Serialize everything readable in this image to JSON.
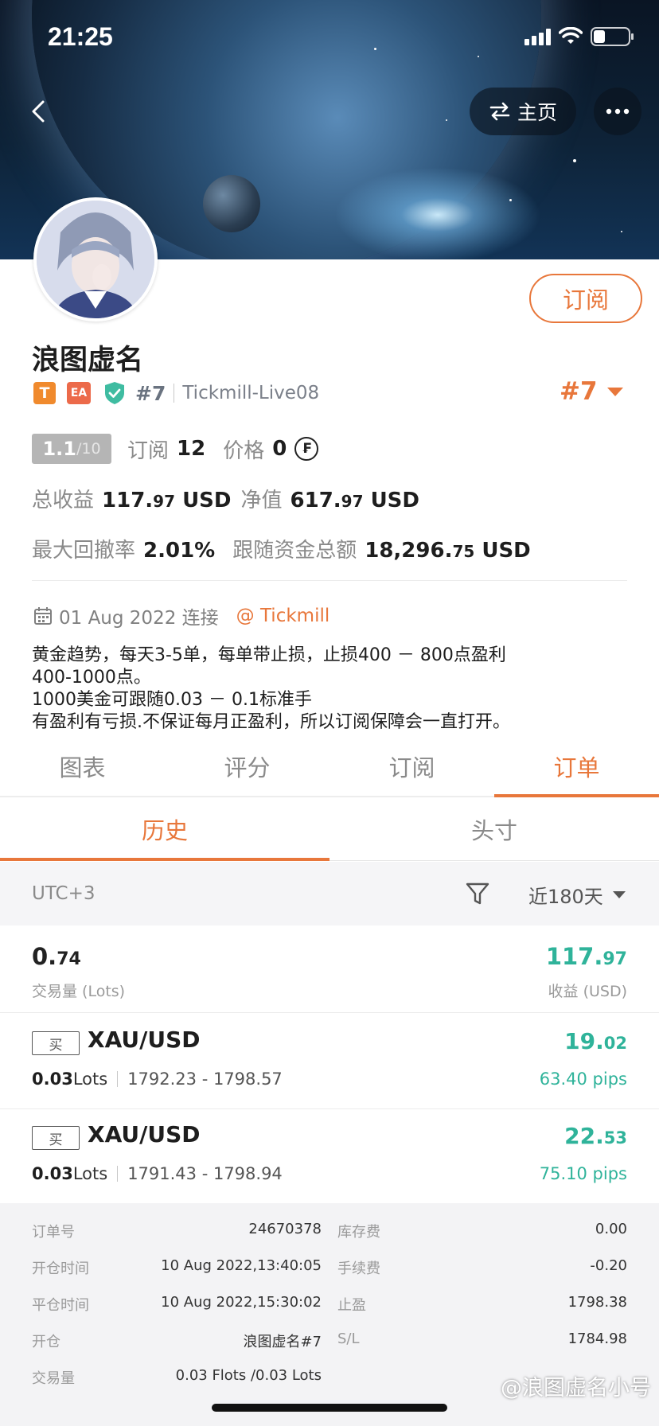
{
  "status_bar": {
    "time": "21:25"
  },
  "header": {
    "home_label": "主页"
  },
  "profile": {
    "name": "浪图虚名",
    "subscribe_label": "订阅",
    "badges": {
      "t": "T",
      "ea": "EA"
    },
    "rank": "#7",
    "server": "Tickmill-Live08",
    "rank_big": "#7",
    "score_main": "1.1",
    "score_den": "/10",
    "subs_label": "订阅",
    "subs_value": "12",
    "price_label": "价格",
    "price_value": "0",
    "coin_glyph": "₣",
    "total_profit_label": "总收益",
    "total_profit_int": "117.",
    "total_profit_dec": "97",
    "total_profit_unit": " USD",
    "equity_label": "净值",
    "equity_int": "617.",
    "equity_dec": "97",
    "equity_unit": " USD",
    "drawdown_label": "最大回撤率",
    "drawdown_value": "2.01%",
    "follow_label": "跟随资金总额",
    "follow_int": "18,296.",
    "follow_dec": "75",
    "follow_unit": " USD",
    "connect_date": "01 Aug 2022 连接",
    "broker": "@ Tickmill",
    "description": "黄金趋势，每天3-5单，每单带止损，止损400 － 800点盈利\n400-1000点。\n1000美金可跟随0.03 － 0.1标准手\n有盈利有亏损.不保证每月正盈利，所以订阅保障会一直打开。"
  },
  "tabs": [
    {
      "label": "图表"
    },
    {
      "label": "评分"
    },
    {
      "label": "订阅"
    },
    {
      "label": "订单"
    }
  ],
  "subtabs": [
    {
      "label": "历史"
    },
    {
      "label": "头寸"
    }
  ],
  "filter": {
    "timezone": "UTC+3",
    "range": "近180天"
  },
  "summary": {
    "volume_int": "0.",
    "volume_dec": "74",
    "volume_label": "交易量 (Lots)",
    "profit_int": "117.",
    "profit_dec": "97",
    "profit_label": "收益 (USD)"
  },
  "orders": [
    {
      "side": "买",
      "symbol": "XAU/USD",
      "lots": "0.03",
      "lots_unit": " Lots",
      "prices": "1792.23 - 1798.57",
      "profit_int": "19.",
      "profit_dec": "02",
      "pips": "63.40 pips"
    },
    {
      "side": "买",
      "symbol": "XAU/USD",
      "lots": "0.03",
      "lots_unit": " Lots",
      "prices": "1791.43 - 1798.94",
      "profit_int": "22.",
      "profit_dec": "53",
      "pips": "75.10 pips"
    }
  ],
  "details": [
    {
      "l1": "订单号",
      "v1": "24670378",
      "l2": "库存费",
      "v2": "0.00"
    },
    {
      "l1": "开仓时间",
      "v1": "10 Aug 2022,13:40:05",
      "l2": "手续费",
      "v2": "-0.20"
    },
    {
      "l1": "平仓时间",
      "v1": "10 Aug 2022,15:30:02",
      "l2": "止盈",
      "v2": "1798.38"
    },
    {
      "l1": "开仓",
      "v1": "浪图虚名#7",
      "l2": "S/L",
      "v2": "1784.98"
    },
    {
      "l1": "交易量",
      "v1": "0.03 Flots /0.03 Lots",
      "l2": "",
      "v2": ""
    }
  ],
  "watermark": "@浪图虚名小号",
  "colors": {
    "accent": "#e8773b",
    "profit": "#2fb39a"
  }
}
